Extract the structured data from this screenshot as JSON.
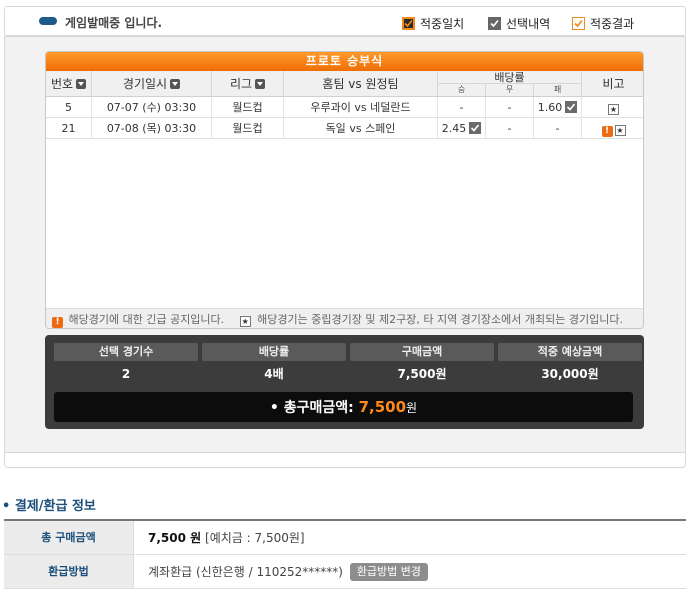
{
  "status": {
    "text": "게임발매중 입니다."
  },
  "legend": {
    "match": "적중일치",
    "selected": "선택내역",
    "result": "적중결과"
  },
  "card": {
    "title": "프로토 승부식",
    "headers": {
      "no": "번호",
      "date": "경기일시",
      "league": "리그",
      "teams": "홈팀 vs 원정팀",
      "odds": "배당률",
      "win": "승",
      "draw": "무",
      "lose": "패",
      "note": "비고"
    },
    "rows": [
      {
        "no": "5",
        "date": "07-07 (수) 03:30",
        "league": "월드컵",
        "home": "우루과이",
        "vs": "vs",
        "away": "네덜란드",
        "win": "-",
        "draw": "-",
        "lose": "1.60",
        "selected": "lose"
      },
      {
        "no": "21",
        "date": "07-08 (목) 03:30",
        "league": "월드컵",
        "home": "독일",
        "vs": "vs",
        "away": "스페인",
        "win": "2.45",
        "draw": "-",
        "lose": "-",
        "selected": "win"
      }
    ],
    "notice_warn": "해당경기에 대한 긴급 공지입니다.",
    "notice_star": "해당경기는 중립경기장 및 제2구장, 타 지역 경기장소에서 개최되는 경기입니다."
  },
  "summary": {
    "labels": [
      "선택 경기수",
      "배당률",
      "구매금액",
      "적중 예상금액"
    ],
    "values": [
      "2",
      "4배",
      "7,500원",
      "30,000원"
    ],
    "total_label": "총구매금액:",
    "total_amount": "7,500",
    "total_unit": "원"
  },
  "payment": {
    "title": "결제/환급 정보",
    "purchase_label": "총 구매금액",
    "purchase_value": "7,500 원",
    "deposit_text": "[예치금 : 7,500원]",
    "refund_label": "환급방법",
    "refund_value": "계좌환급 (신한은행 / 110252******)",
    "refund_button": "환급방법 변경"
  },
  "colors": {
    "accent": "#ef6d05",
    "navy": "#1c4f7c",
    "dark": "#3c3c3c"
  }
}
